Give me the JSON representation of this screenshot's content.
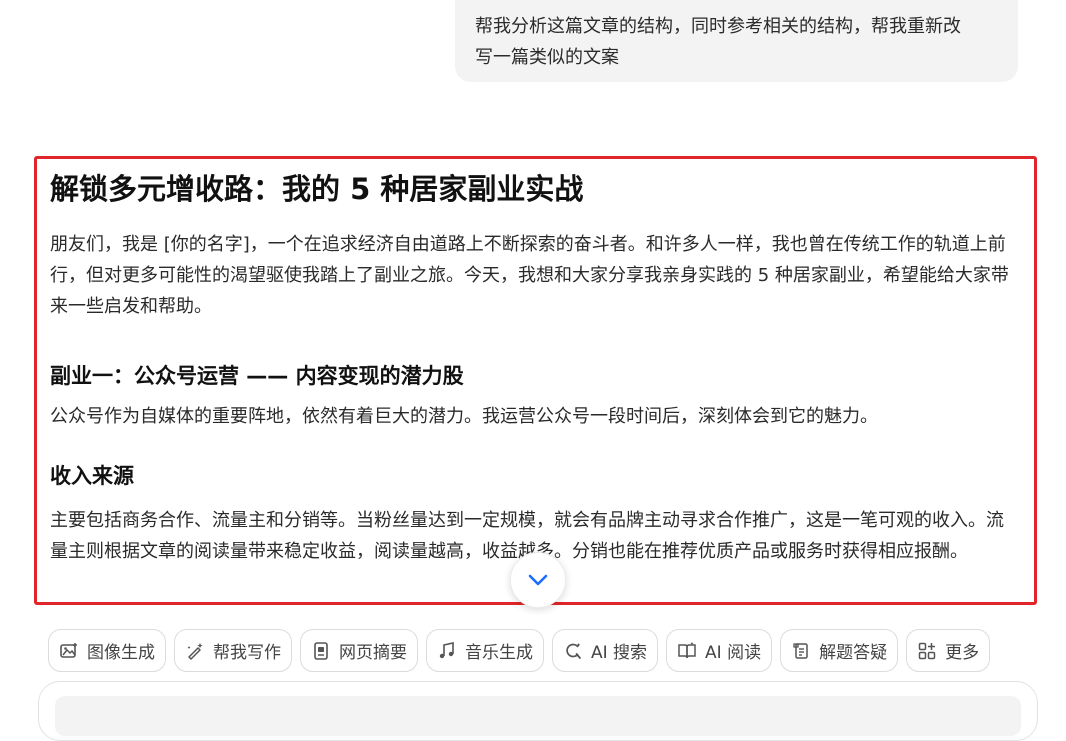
{
  "user_message": {
    "line1": "帮我分析这篇文章的结构，同时参考相关的结构，帮我重新改",
    "line2": "写一篇类似的文案"
  },
  "answer": {
    "title": "解锁多元增收路：我的 5 种居家副业实战",
    "intro": "朋友们，我是 [你的名字]，一个在追求经济自由道路上不断探索的奋斗者。和许多人一样，我也曾在传统工作的轨道上前行，但对更多可能性的渴望驱使我踏上了副业之旅。今天，我想和大家分享我亲身实践的 5 种居家副业，希望能给大家带来一些启发和帮助。",
    "side_job_1_heading": "副业一：公众号运营 —— 内容变现的潜力股",
    "side_job_1_text": "公众号作为自媒体的重要阵地，依然有着巨大的潜力。我运营公众号一段时间后，深刻体会到它的魅力。",
    "income_heading": "收入来源",
    "income_text": "主要包括商务合作、流量主和分销等。当粉丝量达到一定规模，就会有品牌主动寻求合作推广，这是一笔可观的收入。流量主则根据文章的阅读量带来稳定收益，阅读量越高，收益越多。分销也能在推荐优质产品或服务时获得相应报酬。"
  },
  "tools": [
    {
      "label": "图像生成",
      "icon": "image-icon"
    },
    {
      "label": "帮我写作",
      "icon": "pen-sparkle-icon"
    },
    {
      "label": "网页摘要",
      "icon": "web-summary-icon"
    },
    {
      "label": "音乐生成",
      "icon": "music-note-icon"
    },
    {
      "label": "AI 搜索",
      "icon": "ai-search-icon"
    },
    {
      "label": "AI 阅读",
      "icon": "ai-read-icon"
    },
    {
      "label": "解题答疑",
      "icon": "scroll-question-icon"
    },
    {
      "label": "更多",
      "icon": "grid-more-icon"
    }
  ],
  "colors": {
    "highlight_border": "#e0262a",
    "accent": "#1a6dff",
    "bubble_bg": "#f3f3f4"
  }
}
